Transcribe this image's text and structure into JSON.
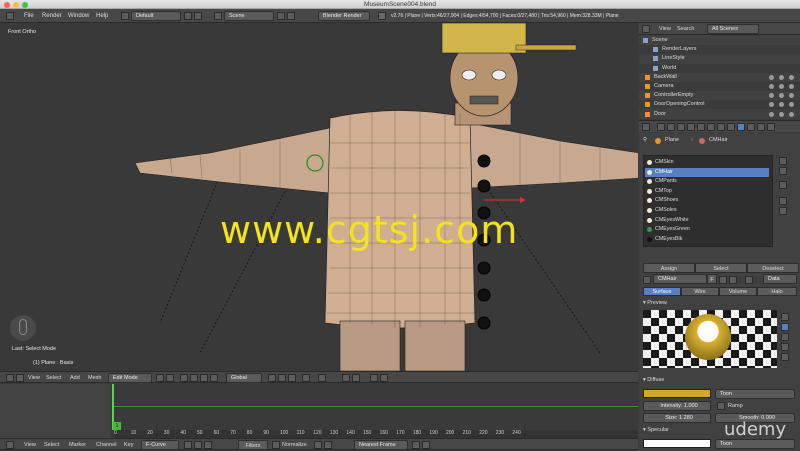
{
  "window": {
    "title": "MuseumScene004.blend"
  },
  "menu": {
    "items": [
      "File",
      "Render",
      "Window",
      "Help"
    ],
    "layout": "Default",
    "scene": "Scene",
    "engine": "Blender Render",
    "stats": "v2.76 | Plane | Verts:46/27,904 | Edges:4/54,700 | Faces:0/27,480 | Tris:54,960 | Mem:328.33M | Plane"
  },
  "viewport": {
    "view_label": "Front Ortho",
    "last_op": "Last: Select Mode",
    "object_label": "(1) Plane : Basis",
    "watermark": "www.cgtsj.com"
  },
  "toolbar3d": {
    "menus": [
      "View",
      "Select",
      "Add",
      "Mesh"
    ],
    "mode": "Edit Mode",
    "orientation": "Global"
  },
  "timeline": {
    "menus": [
      "View",
      "Select",
      "Marker",
      "Channel",
      "Key"
    ],
    "mode": "F-Curve",
    "filters": "Filters",
    "normalize": "Normalize",
    "frame_mode": "Nearest Frame",
    "ticks": [
      "0",
      "10",
      "20",
      "30",
      "40",
      "50",
      "60",
      "70",
      "80",
      "90",
      "100",
      "110",
      "120",
      "130",
      "140",
      "150",
      "160",
      "170",
      "180",
      "190",
      "200",
      "210",
      "220",
      "230",
      "240"
    ],
    "current_frame": "1"
  },
  "outliner": {
    "view": "View",
    "search": "Search",
    "filter": "All Scenes",
    "items": [
      "Scene",
      "RenderLayers",
      "LineStyle",
      "World",
      "BackWall",
      "Camera",
      "ControllerEmpty",
      "DoorOpeningControl",
      "Door"
    ]
  },
  "properties": {
    "breadcrumb_object": "Plane",
    "breadcrumb_material": "CMHair",
    "materials": [
      "CMSkin",
      "CMHair",
      "CMPants",
      "CMTop",
      "CMShoes",
      "CMSoles",
      "CMEyesWhite",
      "CMEyesGreen",
      "CMEyesBlk"
    ],
    "selected_material": "CMHair",
    "assign": "Assign",
    "select": "Select",
    "deselect": "Deselect",
    "material_name": "CMHair",
    "material_users": "F",
    "data_label": "Data",
    "tabs": [
      "Surface",
      "Wire",
      "Volume",
      "Halo"
    ],
    "preview_label": "Preview",
    "diffuse_label": "Diffuse",
    "diffuse_shader": "Toon",
    "intensity_label": "Intensity:",
    "intensity_value": "1.000",
    "ramp_label": "Ramp",
    "size_label": "Size:",
    "size_value": "1.280",
    "smooth_label": "Smooth:",
    "smooth_value": "0.000",
    "specular_label": "Specular",
    "specular_shader": "Toon",
    "diffuse_color": "#d4a72c"
  },
  "udemy": {
    "logo": "udemy"
  }
}
